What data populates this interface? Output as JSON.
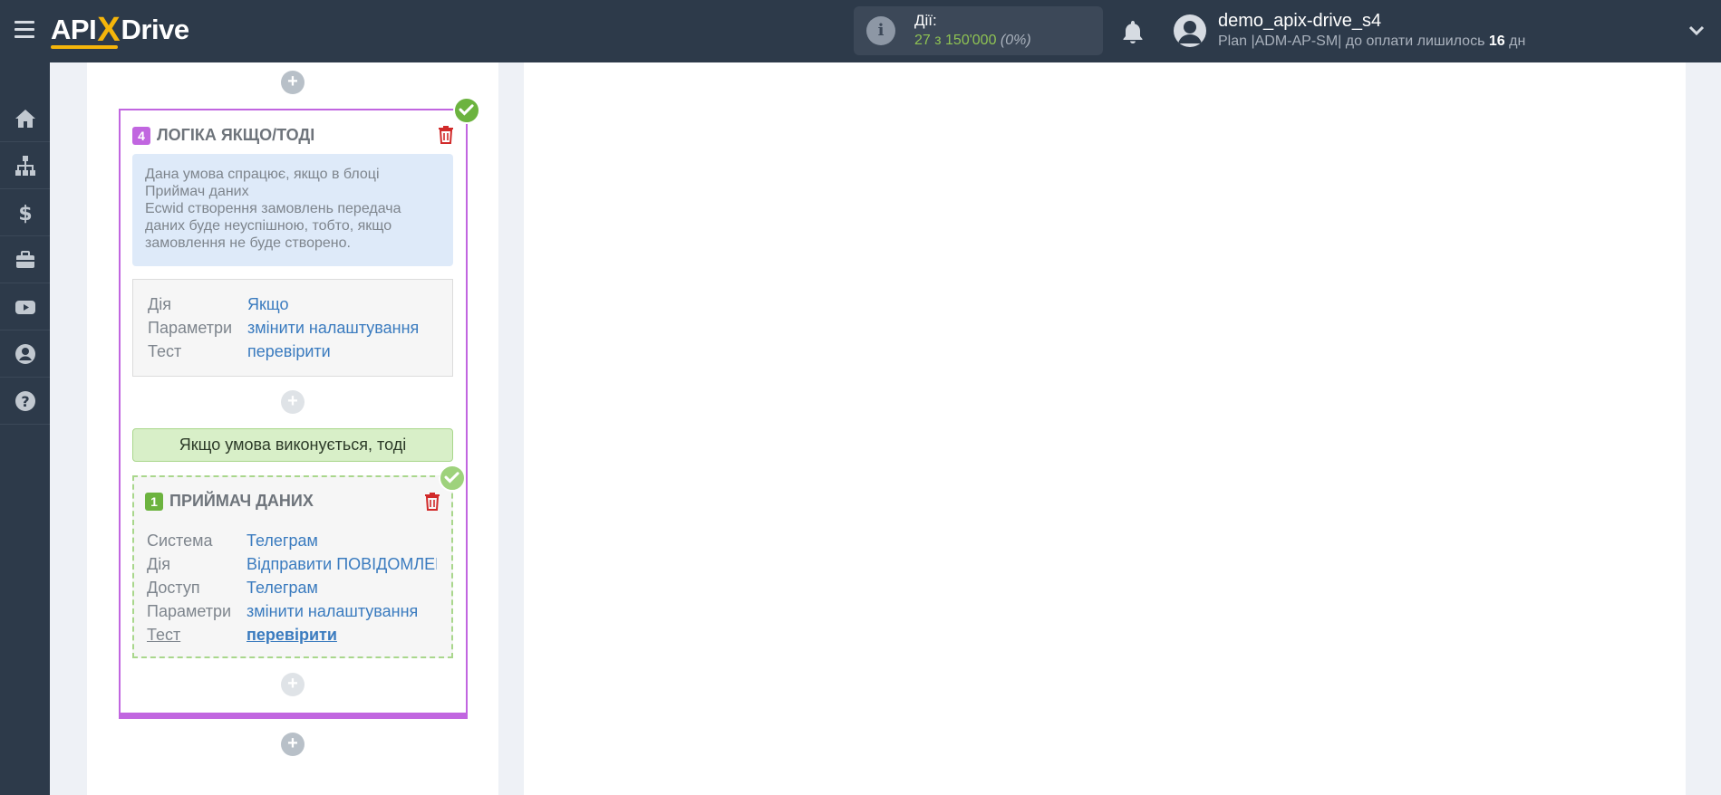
{
  "header": {
    "logo": {
      "part1": "API",
      "x": "X",
      "part2": "Drive"
    },
    "actions": {
      "label": "Дії:",
      "value": "27 з 150'000",
      "percent": "(0%)"
    },
    "user": {
      "name": "demo_apix-drive_s4",
      "plan_prefix": "Plan |ADM-AP-SM| до оплати лишилось ",
      "days": "16",
      "days_suffix": " дн"
    }
  },
  "sidebar": {
    "items": [
      "home-icon",
      "sitemap-icon",
      "dollar-icon",
      "briefcase-icon",
      "youtube-icon",
      "user-icon",
      "help-icon"
    ]
  },
  "logic_block": {
    "number": "4",
    "title": "ЛОГІКА ЯКЩО/ТОДІ",
    "info_lines": [
      "Дана умова спрацює, якщо в блоці",
      "Приймач даних",
      "Ecwid створення замовлень передача",
      "даних буде неуспішною, тобто, якщо",
      "замовлення не буде створено."
    ],
    "params": [
      {
        "key": "Дія",
        "value": "Якщо"
      },
      {
        "key": "Параметри",
        "value": "змінити налаштування"
      },
      {
        "key": "Тест",
        "value": "перевірити"
      }
    ],
    "condition_label": "Якщо умова виконується, тоді"
  },
  "receiver_block": {
    "number": "1",
    "title": "ПРИЙМАЧ ДАНИХ",
    "params": [
      {
        "key": "Система",
        "value": "Телеграм"
      },
      {
        "key": "Дія",
        "value": "Відправити ПОВІДОМЛЕННЯ"
      },
      {
        "key": "Доступ",
        "value": "Телеграм"
      },
      {
        "key": "Параметри",
        "value": "змінити налаштування"
      },
      {
        "key": "Тест",
        "value": "перевірити"
      }
    ]
  },
  "colors": {
    "topbar": "#2d3a4a",
    "logic_border": "#c166e0",
    "receiver_badge": "#6cb33f",
    "link": "#3a7bbf",
    "accent": "#f5b50a"
  }
}
